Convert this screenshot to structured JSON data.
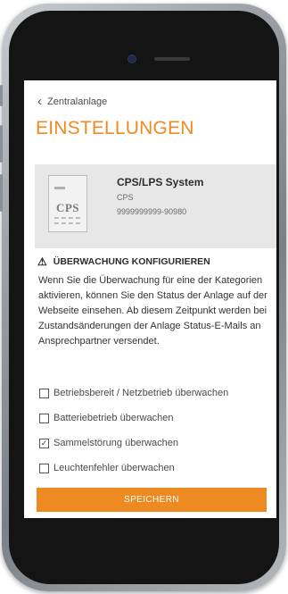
{
  "header": {
    "back_label": "Zentralanlage",
    "title": "EINSTELLUNGEN"
  },
  "device": {
    "name": "CPS/LPS System",
    "type": "CPS",
    "serial": "9999999999-90980",
    "doc_label": "CPS"
  },
  "monitoring": {
    "heading": "ÜBERWACHUNG KONFIGURIEREN",
    "description": "Wenn Sie die Überwachung für eine der Kategorien aktivieren, können Sie den Status der Anlage auf der Webseite einsehen. Ab diesem Zeitpunkt werden bei Zustandsänderungen der Anlage Status-E-Mails an Ansprechpartner versendet.",
    "options": [
      {
        "label": "Betriebsbereit / Netzbetrieb überwachen",
        "checked": false
      },
      {
        "label": "Batteriebetrieb überwachen",
        "checked": false
      },
      {
        "label": "Sammelstörung überwachen",
        "checked": true
      },
      {
        "label": "Leuchtenfehler überwachen",
        "checked": false
      }
    ]
  },
  "actions": {
    "save_label": "SPEICHERN"
  },
  "colors": {
    "accent": "#f08a24",
    "card_bg": "#e7e7e7"
  }
}
